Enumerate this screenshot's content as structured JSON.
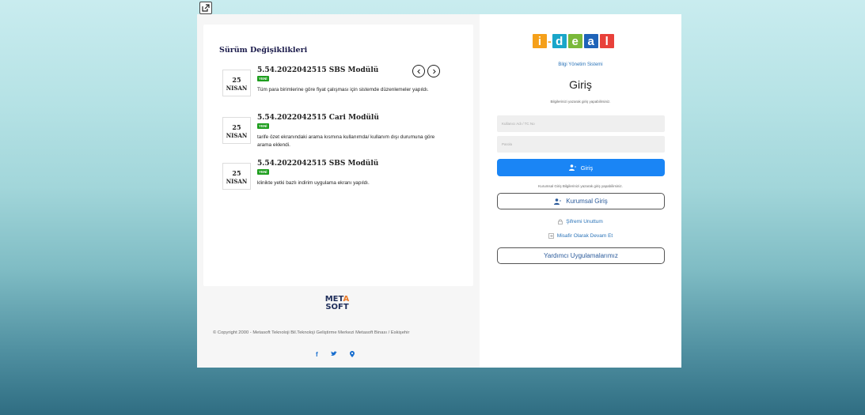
{
  "changes": {
    "title": "Sürüm Değişiklikleri",
    "entries": [
      {
        "day": "25",
        "month": "NISAN",
        "title": "5.54.2022042515 SBS Modülü",
        "badge": "YENİ",
        "description": "Tüm para birimlerine göre fiyat çalışması için sistemde düzenlemeler yapıldı."
      },
      {
        "day": "25",
        "month": "NISAN",
        "title": "5.54.2022042515 Cari Modülü",
        "badge": "YENİ",
        "description": "tarife özet ekranındaki arama kısmına kullanımda/ kullanım dışı durumuna göre arama eklendi."
      },
      {
        "day": "25",
        "month": "NISAN",
        "title": "5.54.2022042515 SBS Modülü",
        "badge": "YENİ",
        "description": "klinikte yetki bazlı indirim uygulama ekranı yapıldı."
      }
    ]
  },
  "footer": {
    "logo_top_left": "MET",
    "logo_top_accent": "A",
    "logo_bottom": "SOFT",
    "copyright": "© Copyright 2000 - Metasoft Teknoloji Bil.Teknoloji Geliştirme Merkezi Metasoft Binası / Eskişehir",
    "social": [
      "facebook-icon",
      "twitter-icon",
      "location-icon"
    ]
  },
  "brand": {
    "letters": [
      "i",
      "d",
      "e",
      "a",
      "l"
    ],
    "colors": [
      "#f5a01a",
      "#1aa6c9",
      "#7ab93a",
      "#1f63b8",
      "#e8413a"
    ],
    "subtitle": "Bilgi Yönetim Sistemi"
  },
  "login": {
    "title": "Giriş",
    "hint": "Bilgilerinizi yazarak giriş yapabilirsiniz.",
    "username_placeholder": "Kullanıcı Adı / TC No",
    "password_placeholder": "Parola",
    "submit_label": "Giriş",
    "corporate_hint": "Kurumsal Giriş Bilgilerinizi yazarak giriş yapabilirsiniz.",
    "corporate_label": "Kurumsal Giriş",
    "forgot_label": "Şifremi Unuttum",
    "guest_label": "Misafir Olarak Devam Et",
    "helper_apps_label": "Yardımcı Uygulamalarımız"
  }
}
